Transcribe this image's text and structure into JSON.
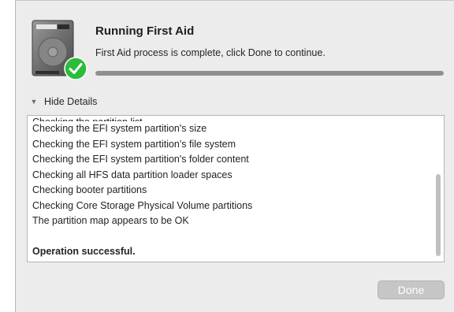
{
  "header": {
    "title": "Running First Aid",
    "message": "First Aid process is complete, click Done to continue."
  },
  "progress": {
    "fraction": 1.0
  },
  "details": {
    "toggle_label": "Hide Details"
  },
  "log": {
    "lines": [
      "Checking the EFI system partition's size",
      "Checking the EFI system partition's file system",
      "Checking the EFI system partition's folder content",
      "Checking all HFS data partition loader spaces",
      "Checking booter partitions",
      "Checking Core Storage Physical Volume partitions",
      "The partition map appears to be OK",
      "",
      "Operation successful."
    ]
  },
  "buttons": {
    "done_label": "Done"
  },
  "icons": {
    "disk": "hard-drive-icon",
    "status": "checkmark-icon",
    "toggle": "disclosure-triangle-icon"
  },
  "colors": {
    "accent_green": "#2bbd3a",
    "progress_fill": "#8f8f8f"
  }
}
